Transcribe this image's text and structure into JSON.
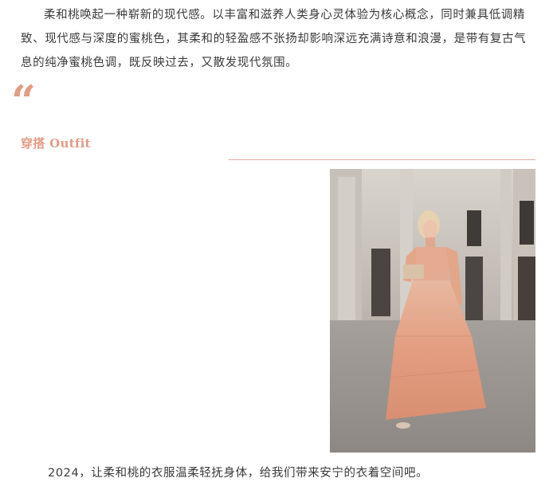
{
  "article": {
    "intro_paragraph": "柔和桃唤起一种崭新的现代感。以丰富和滋养人类身心灵体验为核心概念，同时兼具低调精致、现代感与深度的蜜桃色，其柔和的轻盈感不张扬却影响深远充满诗意和浪漫，是带有复古气息的纯净蜜桃色调，既反映过去，又散发现代氛围。",
    "quote_mark": "“",
    "section_title": "穿搭 Outfit",
    "caption": "2024，让柔和桃的衣服温柔轻抚身体，给我们带来安宁的衣着空间吧。"
  },
  "colors": {
    "accent": "#e39b84",
    "divider": "#e7a9a0",
    "dress": "#e8a587",
    "building": "#cfc9c3"
  }
}
